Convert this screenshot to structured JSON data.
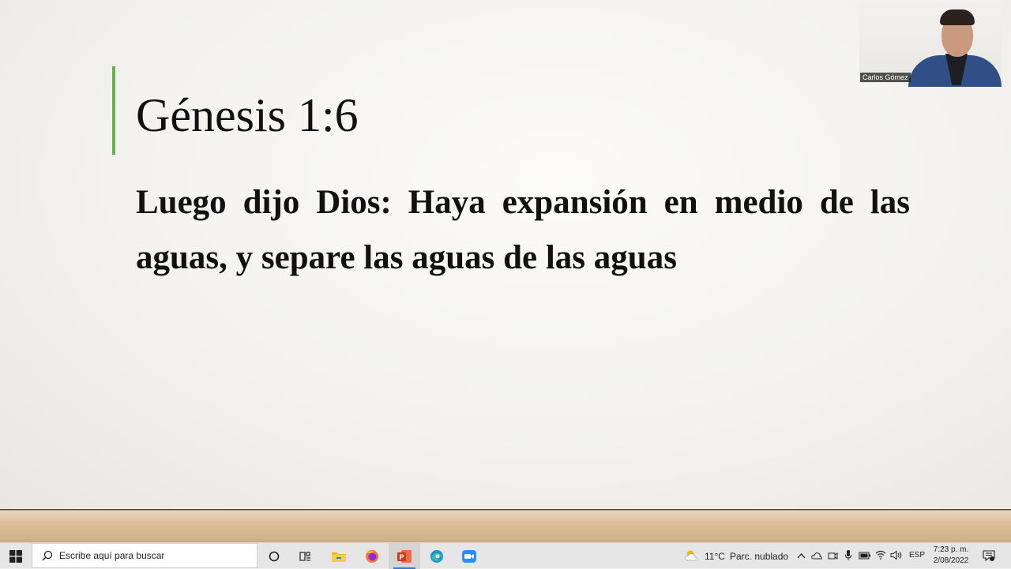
{
  "slide": {
    "title": "Génesis 1:6",
    "body": "Luego dijo Dios: Haya expansión en medio de las aguas, y separe las aguas de las aguas",
    "accent_color": "#6ab04c"
  },
  "video": {
    "participant_name": "Carlos Gómez"
  },
  "taskbar": {
    "search_placeholder": "Escribe aquí para buscar",
    "apps": [
      "cortana-icon",
      "task-view-icon",
      "file-explorer-icon",
      "firefox-icon",
      "powerpoint-icon",
      "edge-icon",
      "zoom-icon"
    ],
    "weather": {
      "temperature": "11°C",
      "condition": "Parc. nublado"
    },
    "language": "ESP",
    "time": "7:23 p. m.",
    "date": "2/08/2022"
  }
}
